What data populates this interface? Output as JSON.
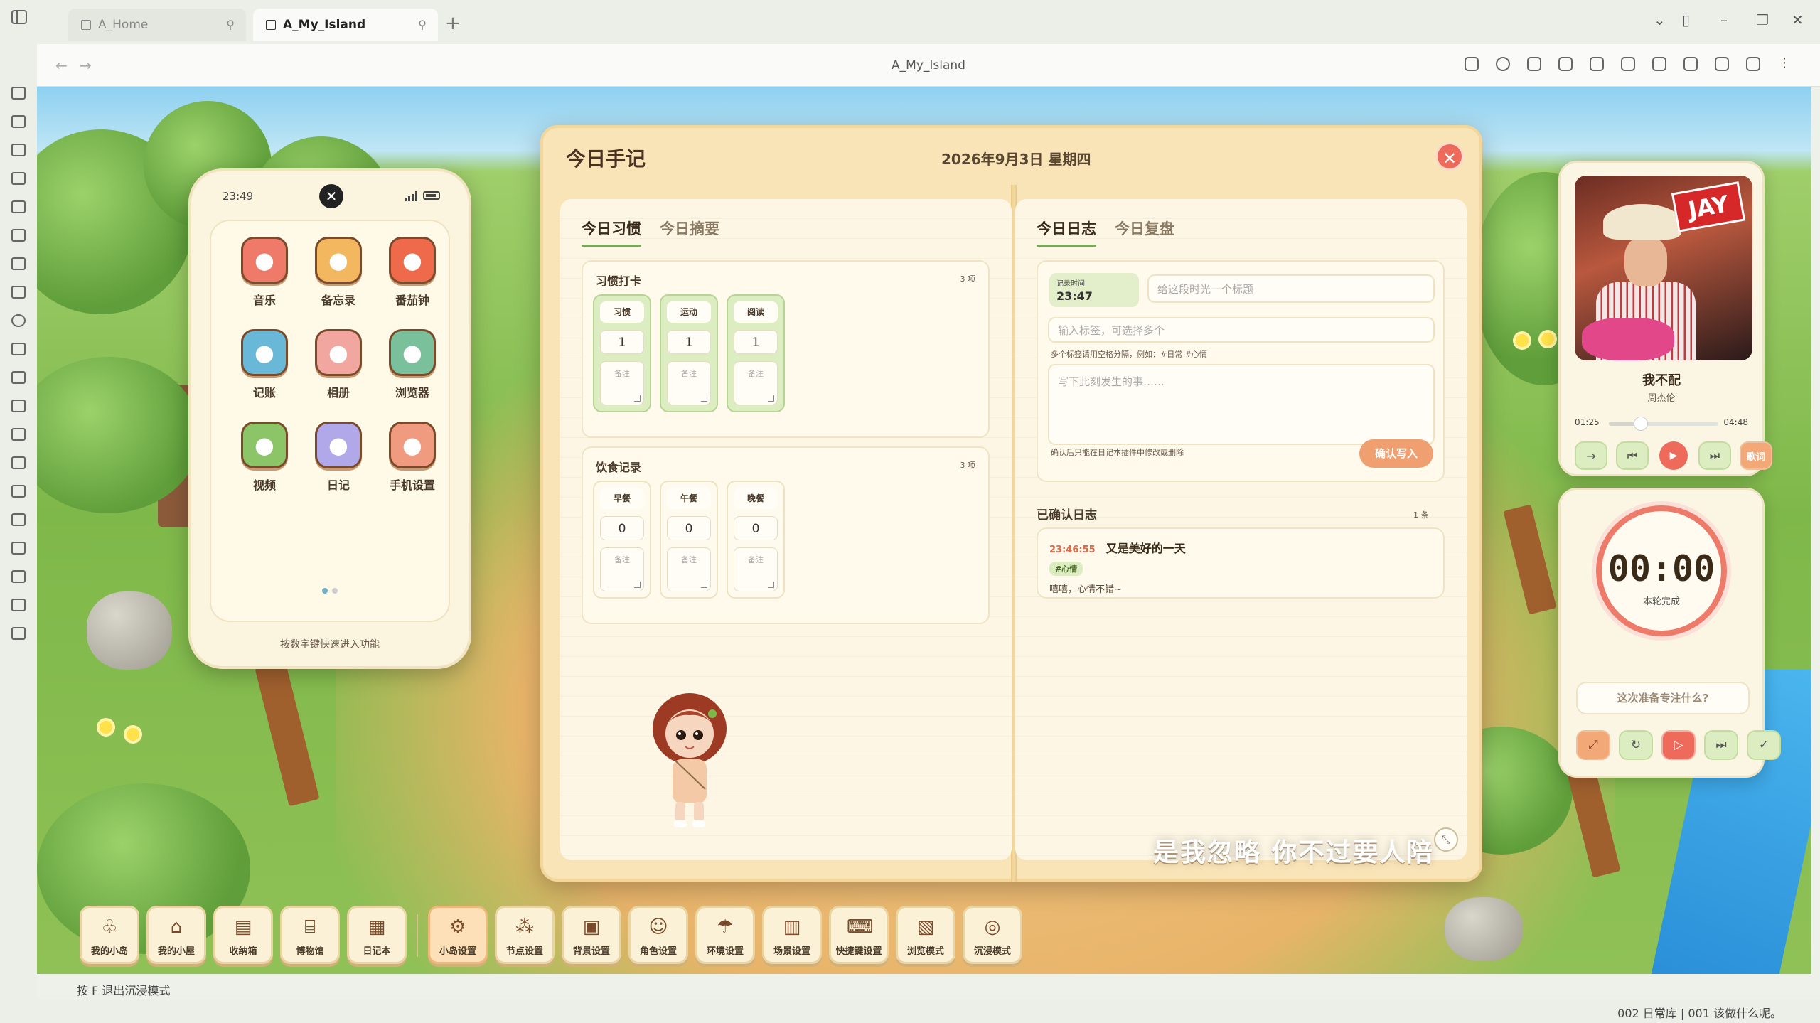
{
  "tabs": [
    {
      "label": "A_Home"
    },
    {
      "label": "A_My_Island"
    }
  ],
  "page": {
    "title": "A_My_Island"
  },
  "phone": {
    "time": "23:49",
    "close_glyph": "✕",
    "apps": [
      {
        "label": "音乐",
        "icon": "music-icon",
        "color": "#ef7a6a"
      },
      {
        "label": "备忘录",
        "icon": "notes-icon",
        "color": "#f3b760"
      },
      {
        "label": "番茄钟",
        "icon": "tomato-clock-icon",
        "color": "#ef6a4a"
      },
      {
        "label": "记账",
        "icon": "calculator-icon",
        "color": "#6ab8d8"
      },
      {
        "label": "相册",
        "icon": "photo-icon",
        "color": "#f2a6a0"
      },
      {
        "label": "浏览器",
        "icon": "globe-icon",
        "color": "#7ac09a"
      },
      {
        "label": "视频",
        "icon": "video-icon",
        "color": "#8cc468"
      },
      {
        "label": "日记",
        "icon": "diary-icon",
        "color": "#b0a8e8"
      },
      {
        "label": "手机设置",
        "icon": "settings-icon",
        "color": "#f09a80"
      }
    ],
    "hint": "按数字键快速进入功能"
  },
  "diary": {
    "title": "今日手记",
    "date": "2026年9月3日 星期四",
    "close_glyph": "✕",
    "left_tabs": [
      "今日习惯",
      "今日摘要"
    ],
    "right_tabs": [
      "今日日志",
      "今日复盘"
    ],
    "habits": {
      "title": "习惯打卡",
      "count": "3 项",
      "items": [
        {
          "name": "习惯",
          "value": "1",
          "note": "备注"
        },
        {
          "name": "运动",
          "value": "1",
          "note": "备注"
        },
        {
          "name": "阅读",
          "value": "1",
          "note": "备注"
        }
      ]
    },
    "meals": {
      "title": "饮食记录",
      "count": "3 项",
      "items": [
        {
          "name": "早餐",
          "value": "0",
          "note": "备注"
        },
        {
          "name": "午餐",
          "value": "0",
          "note": "备注"
        },
        {
          "name": "晚餐",
          "value": "0",
          "note": "备注"
        }
      ]
    },
    "log_form": {
      "record_time_label": "记录时间",
      "record_time": "23:47",
      "title_placeholder": "给这段时光一个标题",
      "tags_placeholder": "输入标签，可选择多个",
      "tags_tip": "多个标签请用空格分隔，例如：#日常 #心情",
      "body_placeholder": "写下此刻发生的事……",
      "confirm_tip": "确认后只能在日记本插件中修改或删除",
      "confirm_button": "确认写入"
    },
    "confirmed": {
      "title": "已确认日志",
      "count": "1 条",
      "entries": [
        {
          "time": "23:46:55",
          "title": "又是美好的一天",
          "tag": "#心情",
          "body": "嘻嘻，心情不错~"
        }
      ]
    }
  },
  "music": {
    "badge": "JAY",
    "song": "我不配",
    "artist": "周杰伦",
    "current": "01:25",
    "total": "04:48",
    "progress": 0.295,
    "lyric_button": "歌词"
  },
  "pomodoro": {
    "time": "00:00",
    "status": "本轮完成",
    "placeholder": "这次准备专注什么?"
  },
  "lyric_line": "是我忽略 你不过要人陪",
  "toolbar": [
    {
      "label": "我的小岛",
      "icon": "island-icon",
      "glyph": "♧"
    },
    {
      "label": "我的小屋",
      "icon": "house-icon",
      "glyph": "⌂"
    },
    {
      "label": "收纳箱",
      "icon": "storage-box-icon",
      "glyph": "▤"
    },
    {
      "label": "博物馆",
      "icon": "museum-icon",
      "glyph": "⌸"
    },
    {
      "label": "日记本",
      "icon": "diary-icon",
      "glyph": "▦"
    },
    {
      "label": "小岛设置",
      "icon": "gear-icon",
      "glyph": "⚙"
    },
    {
      "label": "节点设置",
      "icon": "node-icon",
      "glyph": "⁂"
    },
    {
      "label": "背景设置",
      "icon": "image-icon",
      "glyph": "▣"
    },
    {
      "label": "角色设置",
      "icon": "character-icon",
      "glyph": "☺"
    },
    {
      "label": "环境设置",
      "icon": "weather-icon",
      "glyph": "☂"
    },
    {
      "label": "场景设置",
      "icon": "scene-icon",
      "glyph": "▥"
    },
    {
      "label": "快捷键设置",
      "icon": "keyboard-icon",
      "glyph": "⌨"
    },
    {
      "label": "浏览模式",
      "icon": "map-icon",
      "glyph": "▧"
    },
    {
      "label": "沉浸模式",
      "icon": "focus-icon",
      "glyph": "◎"
    }
  ],
  "exit_hint": "按 F 退出沉浸模式",
  "status": "002 日常库 | 001 该做什么呢。"
}
